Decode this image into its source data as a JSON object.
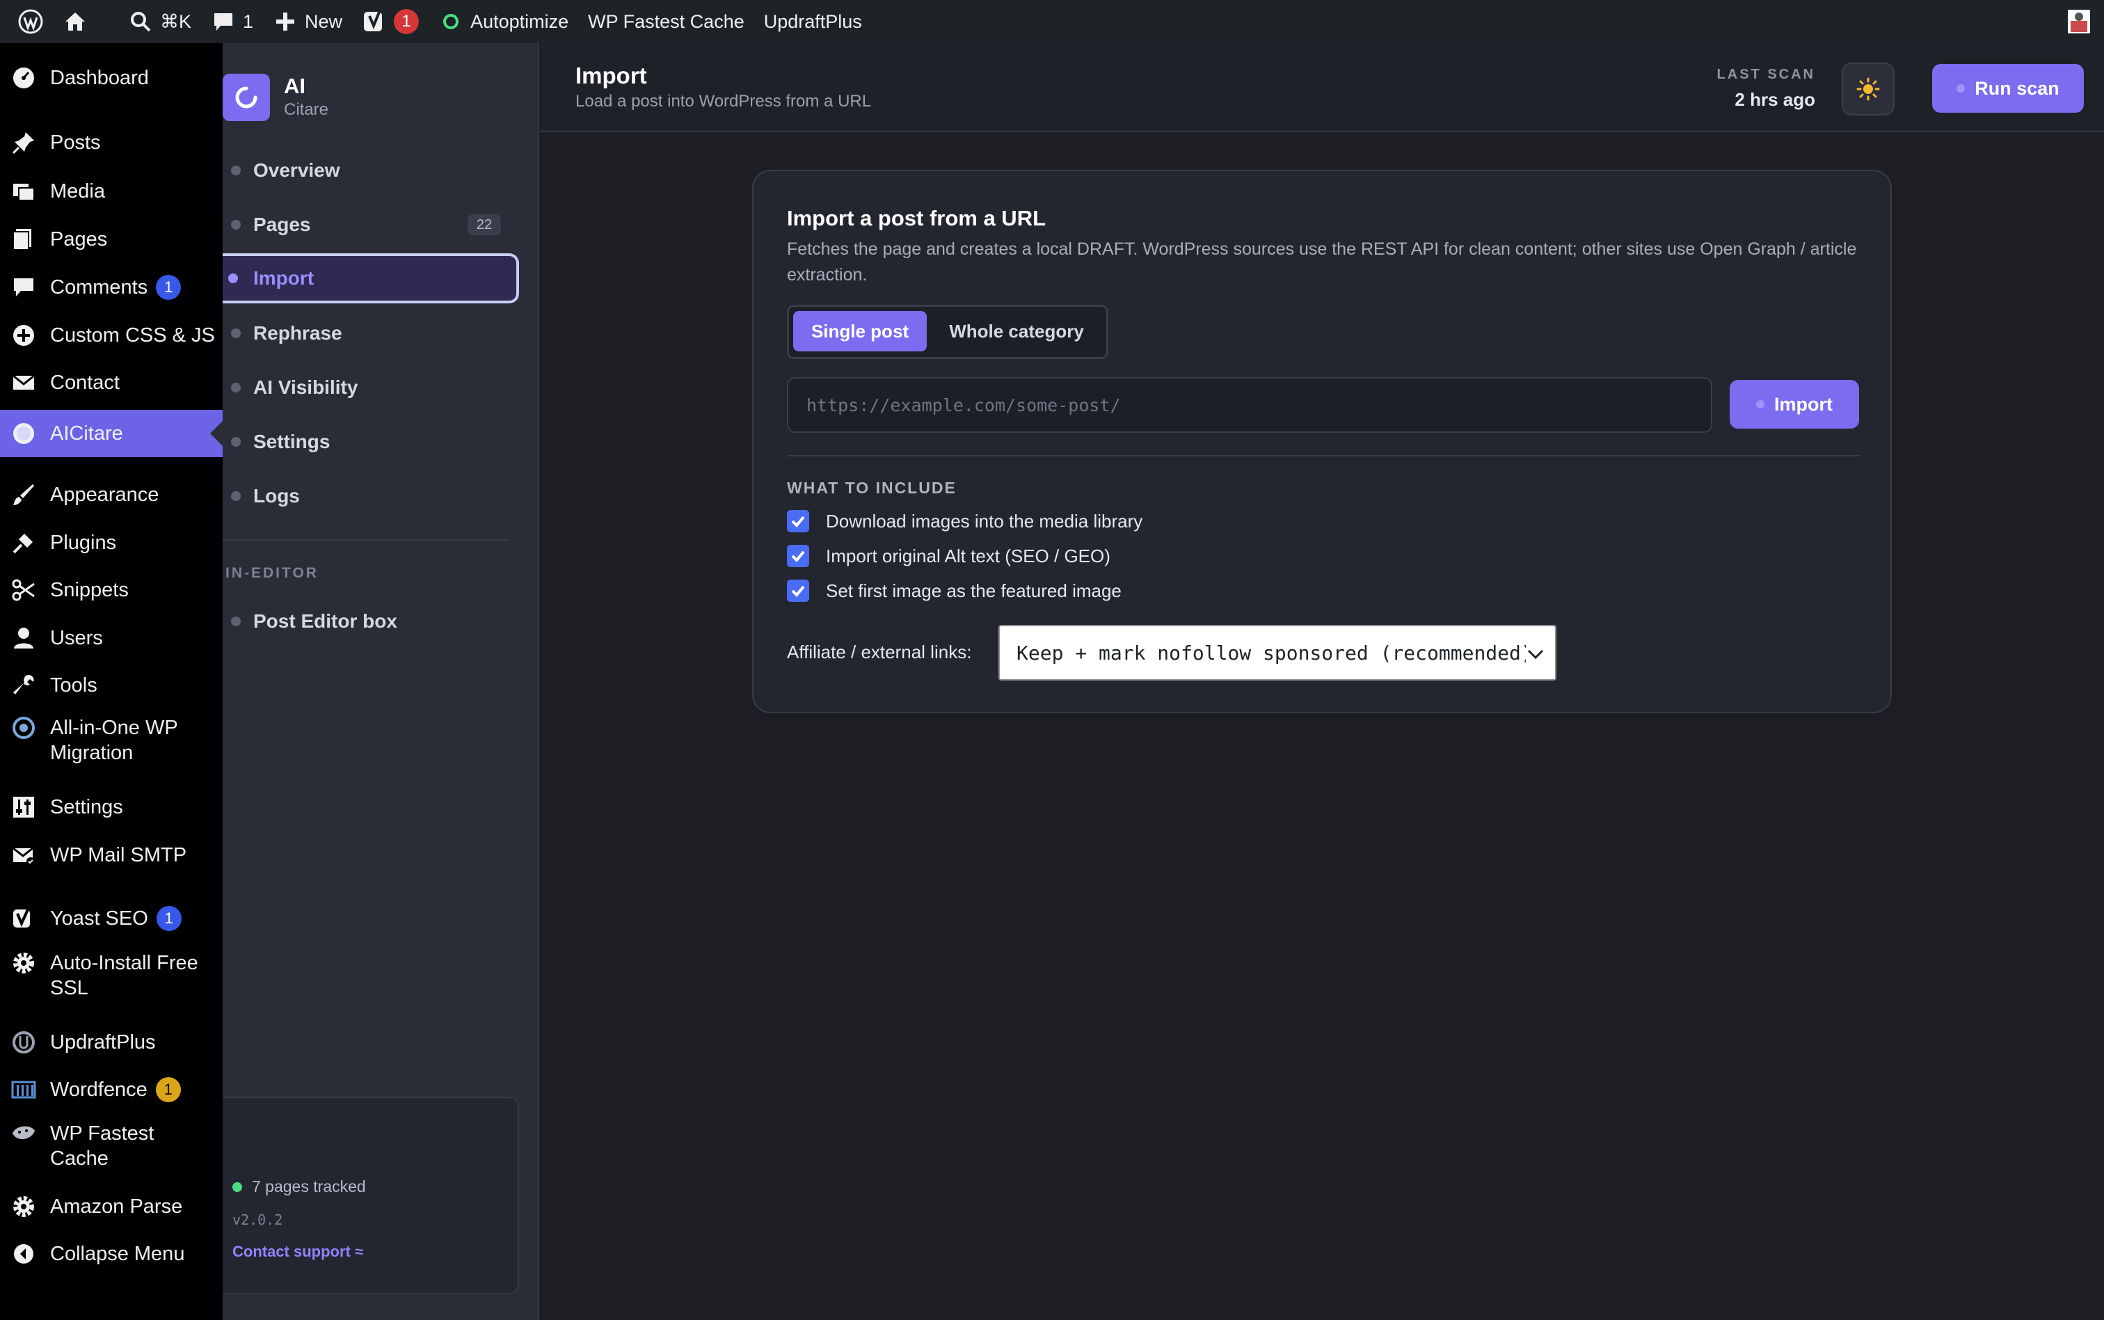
{
  "adminbar": {
    "search_shortcut": "⌘K",
    "comments_count": "1",
    "new_label": "New",
    "yoast_count": "1",
    "autoptimize": "Autoptimize",
    "wp_fastest_cache": "WP Fastest Cache",
    "updraftplus": "UpdraftPlus"
  },
  "wp_menu": {
    "dashboard": "Dashboard",
    "posts": "Posts",
    "media": "Media",
    "pages": "Pages",
    "comments": "Comments",
    "comments_badge": "1",
    "custom_css_js": "Custom CSS & JS",
    "contact": "Contact",
    "aicitare": "AICitare",
    "appearance": "Appearance",
    "plugins": "Plugins",
    "snippets": "Snippets",
    "users": "Users",
    "tools": "Tools",
    "aio_migration_1": "All-in-One WP",
    "aio_migration_2": "Migration",
    "settings": "Settings",
    "wp_mail_smtp": "WP Mail SMTP",
    "yoast_seo": "Yoast SEO",
    "yoast_badge": "1",
    "auto_ssl_1": "Auto-Install Free",
    "auto_ssl_2": "SSL",
    "updraftplus": "UpdraftPlus",
    "wordfence": "Wordfence",
    "wordfence_badge": "1",
    "wpfc_1": "WP Fastest",
    "wpfc_2": "Cache",
    "amazon_parse": "Amazon Parse",
    "collapse": "Collapse Menu"
  },
  "plugin_nav": {
    "brand_name": "AI",
    "brand_sub": "Citare",
    "overview": "Overview",
    "pages": "Pages",
    "pages_count": "22",
    "import": "Import",
    "rephrase": "Rephrase",
    "ai_visibility": "AI Visibility",
    "settings": "Settings",
    "logs": "Logs",
    "section_in_editor": "IN-EDITOR",
    "post_editor_box": "Post Editor box",
    "tracked": "7 pages tracked",
    "version": "v2.0.2",
    "support": "Contact support ≈"
  },
  "header": {
    "title": "Import",
    "subtitle": "Load a post into WordPress from a URL",
    "last_scan_label": "LAST SCAN",
    "last_scan_value": "2 hrs ago",
    "run_scan": "Run scan"
  },
  "import_card": {
    "title": "Import a post from a URL",
    "description": "Fetches the page and creates a local DRAFT. WordPress sources use the REST API for clean content; other sites use Open Graph / article extraction.",
    "mode_single": "Single post",
    "mode_category": "Whole category",
    "url_placeholder": "https://example.com/some-post/",
    "import_button": "Import",
    "section_include": "WHAT TO INCLUDE",
    "opt_download_images": "Download images into the media library",
    "opt_alt_text": "Import original Alt text (SEO / GEO)",
    "opt_featured": "Set first image as the featured image",
    "affiliate_label": "Affiliate / external links:",
    "affiliate_value": "Keep + mark nofollow sponsored (recommended)"
  },
  "colors": {
    "accent": "#7b6cf0",
    "wp_admin_bar": "#1d2327",
    "checkbox": "#4a6cf5"
  },
  "icons": [
    "wordpress-logo-icon",
    "home-icon",
    "search-icon",
    "comment-icon",
    "plus-icon",
    "yoast-icon",
    "status-circle-icon",
    "sun-icon",
    "refresh-icon"
  ]
}
